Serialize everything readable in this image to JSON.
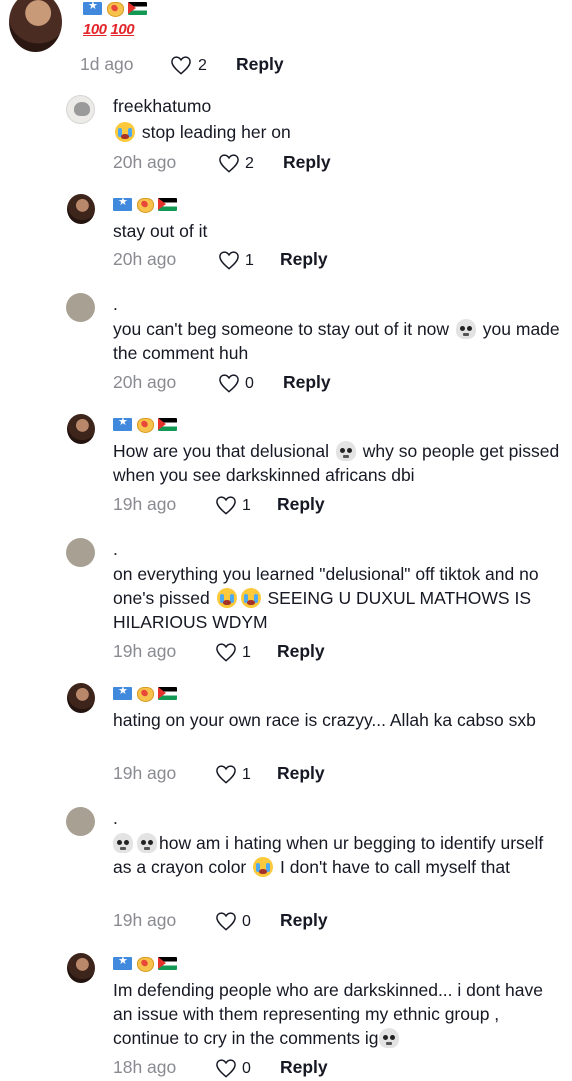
{
  "comments": [
    {
      "username": "",
      "text": "",
      "time": "1d ago",
      "likes": "2",
      "reply_label": "Reply",
      "hundreds": [
        "100",
        "100"
      ]
    },
    {
      "username": "freekhatumo",
      "text": "stop leading her on",
      "time": "20h ago",
      "likes": "2",
      "reply_label": "Reply"
    },
    {
      "username": "",
      "text": "stay out of it",
      "time": "20h ago",
      "likes": "1",
      "reply_label": "Reply"
    },
    {
      "username": ".",
      "text_a": "you can't beg someone to stay out of it now",
      "text_b": "you made the comment huh",
      "time": "20h ago",
      "likes": "0",
      "reply_label": "Reply"
    },
    {
      "username": "",
      "text_a": "How are you that delusional",
      "text_b": "why so people get pissed when you see darkskinned africans dbi",
      "time": "19h ago",
      "likes": "1",
      "reply_label": "Reply"
    },
    {
      "username": ".",
      "text_a": "on everything you learned \"delusional\" off tiktok and no one's pissed",
      "text_b": "SEEING U DUXUL MATHOWS IS HILARIOUS WDYM",
      "time": "19h ago",
      "likes": "1",
      "reply_label": "Reply"
    },
    {
      "username": "",
      "text": "hating on your own race is crazyy... Allah ka cabso sxb",
      "time": "19h ago",
      "likes": "1",
      "reply_label": "Reply"
    },
    {
      "username": ".",
      "text_a": "how am i hating when ur begging to identify urself as a crayon color",
      "text_b": "I don't have to call myself that",
      "time": "19h ago",
      "likes": "0",
      "reply_label": "Reply"
    },
    {
      "username": "",
      "text": "Im defending people who are darkskinned... i dont have an issue with them representing my ethnic group , continue to cry in the comments ig",
      "time": "18h ago",
      "likes": "0",
      "reply_label": "Reply"
    }
  ],
  "icons": {
    "like": "heart-outline-icon",
    "flag_somalia": "somalia-flag-icon",
    "heart_hands": "heart-hands-icon",
    "flag_palestine": "palestine-flag-icon",
    "skull": "skull-emoji-icon",
    "crying": "loudly-crying-emoji-icon"
  },
  "colors": {
    "text": "#161823",
    "muted": "#8a8b91",
    "background": "#ffffff"
  }
}
